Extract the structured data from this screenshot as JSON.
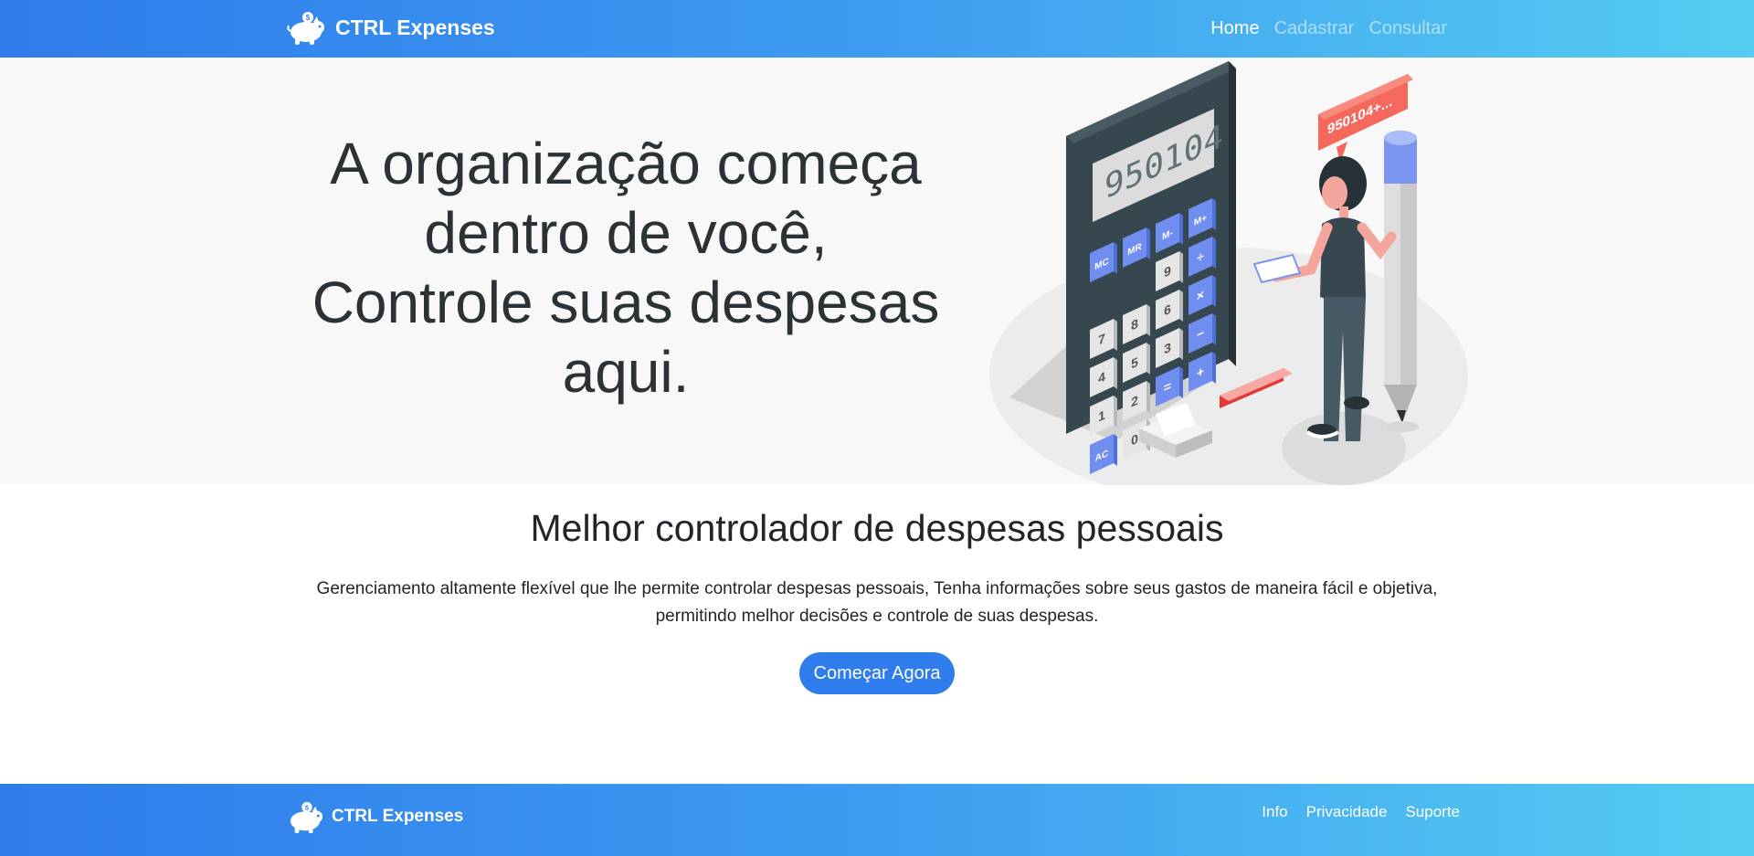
{
  "navbar": {
    "brand": "CTRL Expenses",
    "brand_icon": "piggy-bank-icon",
    "links": [
      {
        "label": "Home",
        "active": true
      },
      {
        "label": "Cadastrar",
        "active": false
      },
      {
        "label": "Consultar",
        "active": false
      }
    ]
  },
  "hero": {
    "title_lines": [
      "A organização começa",
      "dentro de você,",
      "Controle suas despesas",
      "aqui."
    ],
    "illustration": {
      "calculator_display": "950104",
      "speech_bubble": "950104+...",
      "keys": [
        "MC",
        "MR",
        "M-",
        "M+",
        "9",
        "÷",
        "7",
        "8",
        "6",
        "×",
        "4",
        "5",
        "3",
        "−",
        "1",
        "2",
        "=",
        "+",
        "AC",
        "0"
      ]
    }
  },
  "section": {
    "title": "Melhor controlador de despesas pessoais",
    "text_line1": "Gerenciamento altamente flexível que lhe permite controlar despesas pessoais, Tenha informações sobre seus gastos de maneira fácil e objetiva,",
    "text_line2": "permitindo melhor decisões e controle de suas despesas.",
    "cta_label": "Começar Agora"
  },
  "footer": {
    "brand": "CTRL Expenses",
    "links": [
      "Info",
      "Privacidade",
      "Suporte"
    ]
  },
  "colors": {
    "primary": "#2f7cec",
    "gradient_end": "#55cdf2",
    "hero_bg": "#f8f8f8",
    "accent_red": "#f4695b",
    "key_blue": "#6f8ef0"
  }
}
